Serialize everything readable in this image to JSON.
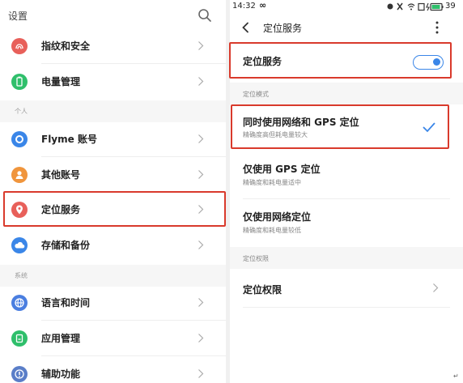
{
  "left": {
    "title": "设置",
    "items_top": [
      {
        "label": "指纹和安全",
        "icon": "fingerprint-icon",
        "color": "#e8605a"
      },
      {
        "label": "电量管理",
        "icon": "battery-icon",
        "color": "#2fbf6b"
      }
    ],
    "section_personal": "个人",
    "items_personal": [
      {
        "label": "Flyme 账号",
        "icon": "flyme-account-icon",
        "color": "#3a86e8"
      },
      {
        "label": "其他账号",
        "icon": "person-icon",
        "color": "#f0953c"
      },
      {
        "label": "定位服务",
        "icon": "location-pin-icon",
        "color": "#e8605a"
      },
      {
        "label": "存储和备份",
        "icon": "cloud-icon",
        "color": "#3a86e8"
      }
    ],
    "section_system": "系统",
    "items_system": [
      {
        "label": "语言和时间",
        "icon": "globe-icon",
        "color": "#4a7ee0"
      },
      {
        "label": "应用管理",
        "icon": "app-icon",
        "color": "#2fbf6b"
      },
      {
        "label": "辅助功能",
        "icon": "accessibility-icon",
        "color": "#5a7ec8"
      }
    ]
  },
  "right": {
    "status": {
      "time": "14:32",
      "infinity": "∞",
      "battery": "39"
    },
    "appbar_title": "定位服务",
    "toggle_row": {
      "label": "定位服务",
      "on": true
    },
    "section_mode": "定位模式",
    "modes": [
      {
        "title": "同时使用网络和 GPS 定位",
        "subtitle": "精确度高但耗电量较大",
        "selected": true
      },
      {
        "title": "仅使用 GPS 定位",
        "subtitle": "精确度和耗电量适中",
        "selected": false
      },
      {
        "title": "仅使用网络定位",
        "subtitle": "精确度和耗电量较低",
        "selected": false
      }
    ],
    "section_perm": "定位权限",
    "perm_row": {
      "label": "定位权限"
    }
  },
  "colors": {
    "accent": "#3a86e8",
    "highlight": "#d93a2c"
  },
  "corner_mark": "↵"
}
